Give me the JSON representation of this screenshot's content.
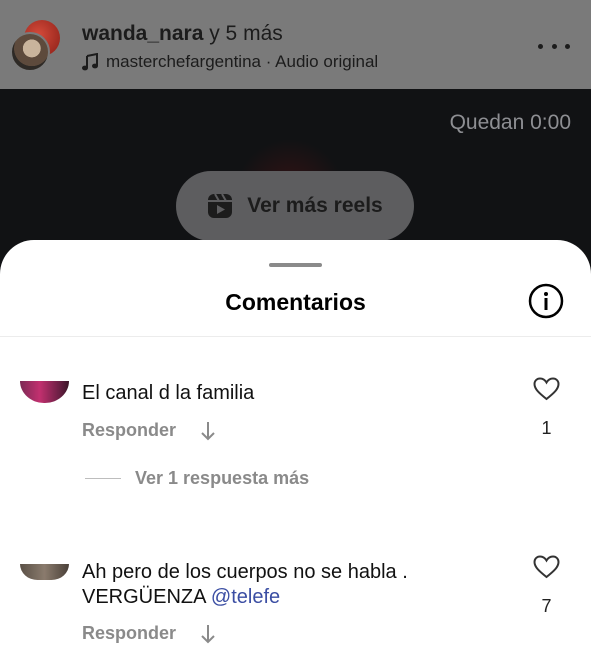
{
  "header": {
    "username": "wanda_nara",
    "collaborators_suffix": " y 5 más",
    "audio_account": "masterchefargentina",
    "audio_separator": " · ",
    "audio_label": "Audio original",
    "music_icon": "music-note-icon",
    "more_icon": "more-horizontal-icon"
  },
  "video": {
    "remaining_label": "Quedan 0:00",
    "reels_button_label": "Ver más reels",
    "reels_icon": "reels-icon"
  },
  "comments_sheet": {
    "title": "Comentarios",
    "info_icon": "info-icon",
    "comments": [
      {
        "text": "El canal d la familia",
        "reply_label": "Responder",
        "likes": "1",
        "more_replies_label": "Ver 1 respuesta más"
      },
      {
        "text_line1": "Ah pero de los cuerpos no se habla .",
        "text_line2_prefix": "VERGÜENZA ",
        "mention": "@telefe",
        "reply_label": "Responder",
        "likes": "7"
      }
    ]
  },
  "colors": {
    "header_overlay": "#7a7a7a",
    "video_bg": "#111214",
    "sheet_bg": "#ffffff",
    "secondary_text": "#8a8a8a",
    "mention": "#3b4ea3"
  }
}
